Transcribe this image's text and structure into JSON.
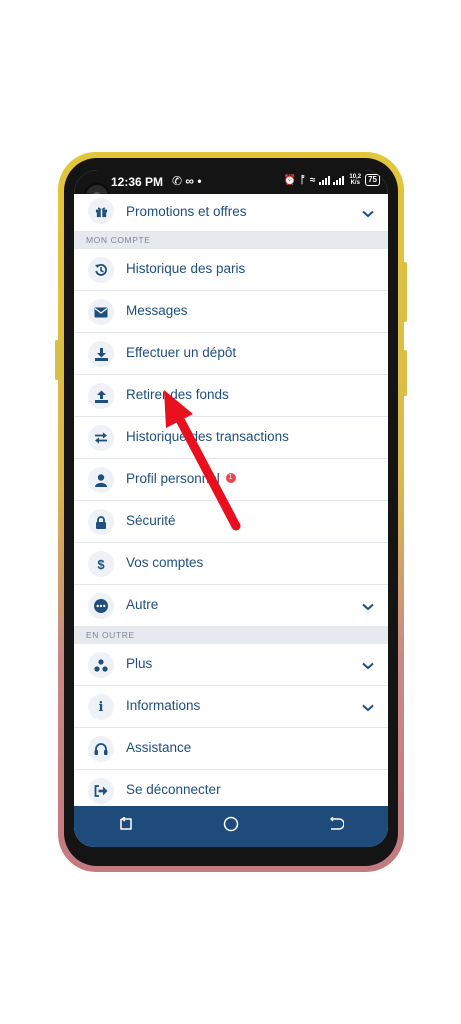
{
  "status_bar": {
    "time": "12:36 PM",
    "net_speed_top": "10,2",
    "net_speed_unit": "K/s",
    "battery": "75"
  },
  "menu": {
    "top_item": {
      "label": "Promotions et offres",
      "icon": "gift-icon"
    },
    "section_account": "MON COMPTE",
    "account_items": [
      {
        "label": "Historique des paris",
        "icon": "history-icon"
      },
      {
        "label": "Messages",
        "icon": "envelope-icon"
      },
      {
        "label": "Effectuer un dépôt",
        "icon": "download-icon"
      },
      {
        "label": "Retirer des fonds",
        "icon": "upload-icon"
      },
      {
        "label": "Historique des transactions",
        "icon": "transfer-icon"
      },
      {
        "label": "Profil personnel",
        "icon": "user-icon",
        "badge": "1"
      },
      {
        "label": "Sécurité",
        "icon": "lock-icon"
      },
      {
        "label": "Vos comptes",
        "icon": "dollar-icon"
      },
      {
        "label": "Autre",
        "icon": "ellipsis-icon"
      }
    ],
    "section_more": "EN OUTRE",
    "more_items": [
      {
        "label": "Plus",
        "icon": "dots-cluster-icon"
      },
      {
        "label": "Informations",
        "icon": "info-icon"
      },
      {
        "label": "Assistance",
        "icon": "headset-icon"
      },
      {
        "label": "Se déconnecter",
        "icon": "logout-icon"
      }
    ]
  },
  "colors": {
    "primary": "#1f4f7d",
    "navbar": "#1f4b7b",
    "badge": "#e9474f",
    "arrow": "#e8101c"
  }
}
